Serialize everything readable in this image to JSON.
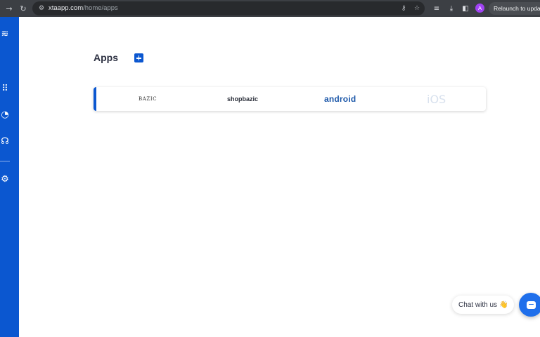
{
  "browser": {
    "url_host": "xtaapp.com",
    "url_path": "/home/apps",
    "profile_initial": "A",
    "relaunch_label": "Relaunch to update",
    "icons": [
      "forward-icon",
      "reload-icon",
      "site-settings-icon",
      "password-key-icon",
      "bookmark-star-icon",
      "extension-icon",
      "download-icon",
      "side-panel-icon"
    ]
  },
  "sidebar": {
    "items": [
      {
        "name": "logo-icon"
      },
      {
        "name": "apps-grid-icon"
      },
      {
        "name": "history-icon"
      },
      {
        "name": "support-icon"
      },
      {
        "name": "settings-gear-icon"
      }
    ]
  },
  "main": {
    "title": "Apps",
    "apps": [
      {
        "label": "BAZIC"
      },
      {
        "label": "shopbazic"
      },
      {
        "label": "android"
      },
      {
        "label": "iOS"
      }
    ]
  },
  "chat": {
    "bubble_text": "Chat with us",
    "wave_emoji": "👋"
  },
  "colors": {
    "accent": "#0b57d0",
    "browser_bar": "#3c3f44",
    "chat_launcher": "#1f6feb"
  }
}
